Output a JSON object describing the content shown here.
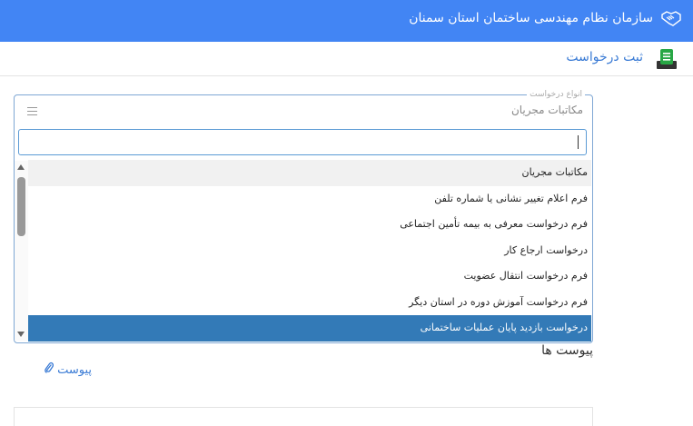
{
  "app": {
    "title": "سازمان نظام مهندسی ساختمان استان سمنان",
    "brand_icon": "handshake-icon"
  },
  "page": {
    "title": "ثبت درخواست",
    "icon": "document-icon",
    "icon_color": "#28a745"
  },
  "request_type": {
    "legend": "انواع درخواست",
    "selected": "مکاتبات مجریان",
    "search_value": "",
    "options": [
      "مکاتبات مجریان",
      "فرم اعلام تغییر نشانی یا شماره تلفن",
      "فرم درخواست معرفی به بیمه تأمین اجتماعی",
      "درخواست ارجاع کار",
      "فرم درخواست انتقال عضویت",
      "فرم درخواست آموزش دوره در استان دیگر",
      "درخواست بازدید پایان عملیات ساختمانی"
    ],
    "highlighted_index": 6
  },
  "attachments": {
    "heading": "پیوست ها",
    "link_label": "پیوست",
    "link_icon": "paperclip-icon"
  },
  "colors": {
    "topbar": "#4285f4",
    "highlight": "#337ab7",
    "link": "#3a7bd5"
  }
}
